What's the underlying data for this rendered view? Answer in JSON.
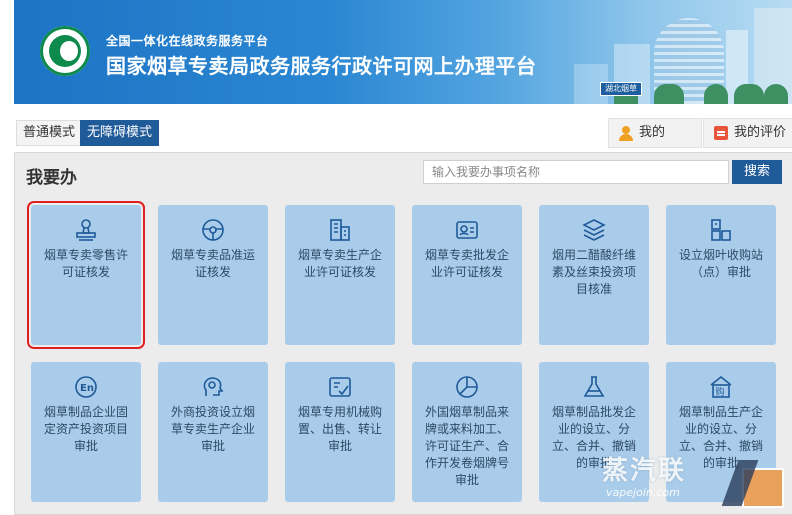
{
  "banner": {
    "subtitle": "全国一体化在线政务服务平台",
    "title": "国家烟草专卖局政务服务行政许可网上办理平台",
    "sign": "湖北烟草"
  },
  "modes": {
    "normal": "普通模式",
    "accessible": "无障碍模式"
  },
  "user": {
    "mine": "我的",
    "my_evaluation": "我的评价"
  },
  "panel": {
    "title": "我要办",
    "search_placeholder": "输入我要办事项名称",
    "search_button": "搜索"
  },
  "tiles": [
    {
      "label": "烟草专卖零售许可证核发",
      "icon": "stamp-icon",
      "selected": true
    },
    {
      "label": "烟草专卖品准运证核发",
      "icon": "steering-wheel-icon"
    },
    {
      "label": "烟草专卖生产企业许可证核发",
      "icon": "building-icon"
    },
    {
      "label": "烟草专卖批发企业许可证核发",
      "icon": "id-card-icon"
    },
    {
      "label": "烟用二醋酸纤维素及丝束投资项目核准",
      "icon": "layers-icon"
    },
    {
      "label": "设立烟叶收购站（点）审批",
      "icon": "grid-blocks-icon"
    },
    {
      "label": "烟草制品企业固定资产投资项目审批",
      "icon": "en-circle-icon"
    },
    {
      "label": "外商投资设立烟草专卖生产企业审批",
      "icon": "head-gear-icon"
    },
    {
      "label": "烟草专用机械购置、出售、转让审批",
      "icon": "checklist-icon"
    },
    {
      "label": "外国烟草制品来牌或来料加工、许可证生产、合作开发卷烟牌号审批",
      "icon": "pie-chart-icon"
    },
    {
      "label": "烟草制品批发企业的设立、分立、合并、撤销的审批",
      "icon": "flask-icon"
    },
    {
      "label": "烟草制品生产企业的设立、分立、合并、撤销的审批",
      "icon": "shopping-house-icon"
    }
  ],
  "watermark": {
    "text": "蒸汽联",
    "url": "vapejoin.com"
  },
  "colors": {
    "accent": "#1f5a99",
    "tile": "#a9ccea",
    "highlight": "#e02020"
  }
}
